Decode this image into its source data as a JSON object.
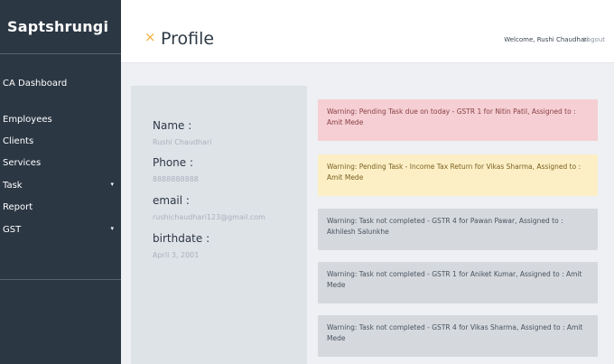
{
  "sidebar": {
    "brand": "Saptshrungi",
    "items": [
      {
        "label": "CA Dashboard",
        "caret": ""
      },
      {
        "label": "Employees",
        "caret": ""
      },
      {
        "label": "Clients",
        "caret": ""
      },
      {
        "label": "Services",
        "caret": ""
      },
      {
        "label": "Task",
        "caret": "▾"
      },
      {
        "label": "Report",
        "caret": ""
      },
      {
        "label": "GST",
        "caret": "▾"
      }
    ]
  },
  "header": {
    "close_glyph": "×",
    "title": "Profile",
    "welcome": "Welcome, Rushi Chaudhari",
    "logout": "Logout"
  },
  "profile": {
    "name_label": "Name :",
    "name_value": "Rushi Chaudhari",
    "phone_label": "Phone :",
    "phone_value": "8888888888",
    "email_label": "email :",
    "email_value": "rushichaudhari123@gmail.com",
    "birthdate_label": "birthdate :",
    "birthdate_value": "April 3, 2001"
  },
  "alerts": [
    {
      "type": "danger",
      "text": "Warning: Pending Task due on today - GSTR 1 for Nitin Patil, Assigned to : Amit Mede"
    },
    {
      "type": "warning",
      "text": "Warning: Pending Task - Income Tax Return for Vikas Sharma, Assigned to : Amit Mede"
    },
    {
      "type": "muted",
      "text": "Warning: Task not completed - GSTR 4 for Pawan Pawar, Assigned to : Akhilesh Salunkhe"
    },
    {
      "type": "muted",
      "text": "Warning: Task not completed - GSTR 1 for Aniket Kumar, Assigned to : Amit Mede"
    },
    {
      "type": "muted",
      "text": "Warning: Task not completed - GSTR 4 for Vikas Sharma, Assigned to : Amit Mede"
    }
  ],
  "colors": {
    "sidebar_bg": "#2c3744",
    "accent": "#f0b23c",
    "alert_danger": "#f5cfd3",
    "alert_warning": "#fcefc6",
    "alert_muted": "#d5d9de"
  }
}
